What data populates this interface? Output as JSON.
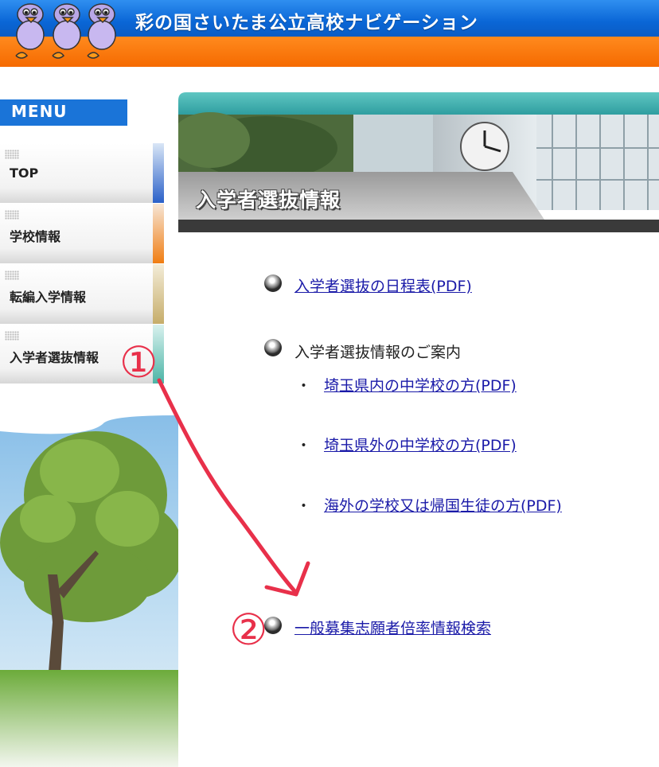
{
  "header": {
    "site_title": "彩の国さいたま公立高校ナビゲーション"
  },
  "sidebar": {
    "menu_label": "MENU",
    "items": [
      {
        "label": "TOP"
      },
      {
        "label": "学校情報"
      },
      {
        "label": "転編入学情報"
      },
      {
        "label": "入学者選抜情報"
      }
    ]
  },
  "banner": {
    "title": "入学者選抜情報"
  },
  "content": {
    "schedule_link": "入学者選抜の日程表(PDF)",
    "guide_heading": "入学者選抜情報のご案内",
    "guide_links": [
      "埼玉県内の中学校の方(PDF)",
      "埼玉県外の中学校の方(PDF)",
      "海外の学校又は帰国生徒の方(PDF)"
    ],
    "bullet_mark": "・",
    "ratio_link": "一般募集志願者倍率情報検索"
  },
  "annotations": {
    "marker_1": "①",
    "marker_2": "②",
    "color": "#e8304a"
  },
  "colors": {
    "header_blue": "#0a66d6",
    "header_orange": "#f56a00",
    "menu_blue": "#1a74d8",
    "link": "#1a1aa8"
  }
}
